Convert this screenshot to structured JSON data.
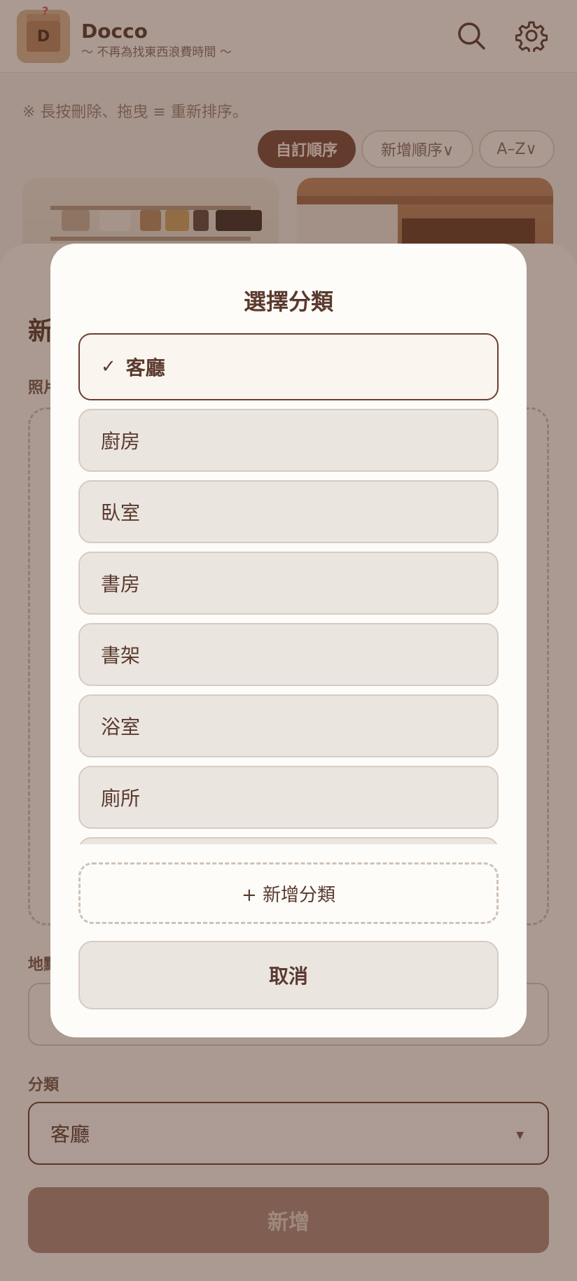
{
  "app": {
    "title": "Docco",
    "subtitle": "〜 不再為找東西浪費時間 〜",
    "logo_letter": "D",
    "logo_mark": "?"
  },
  "toolbar": {
    "hint": "※ 長按刪除、拖曳 ≡ 重新排序。",
    "sort_buttons": [
      {
        "label": "自訂順序",
        "active": true
      },
      {
        "label": "新增順序∨",
        "active": false
      },
      {
        "label": "A–Z∨",
        "active": false
      }
    ]
  },
  "sheet": {
    "title": "新增",
    "photo_label": "照片",
    "location_label": "地點",
    "category_label": "分類",
    "category_value": "客廳",
    "submit_label": "新增"
  },
  "modal": {
    "title": "選擇分類",
    "selected_mark": "✓",
    "options": [
      "客廳",
      "廚房",
      "臥室",
      "書房",
      "書架",
      "浴室",
      "廁所"
    ],
    "add_label": "+ 新增分類",
    "cancel_label": "取消"
  },
  "icons": {
    "search": "search-icon",
    "settings": "gear-icon",
    "check": "check-icon",
    "dropdown": "caret-down-icon"
  },
  "colors": {
    "primary": "#6b3f30",
    "text": "#5a3a2e",
    "option_bg": "#ebe5e0",
    "modal_bg": "#fefcf8"
  }
}
